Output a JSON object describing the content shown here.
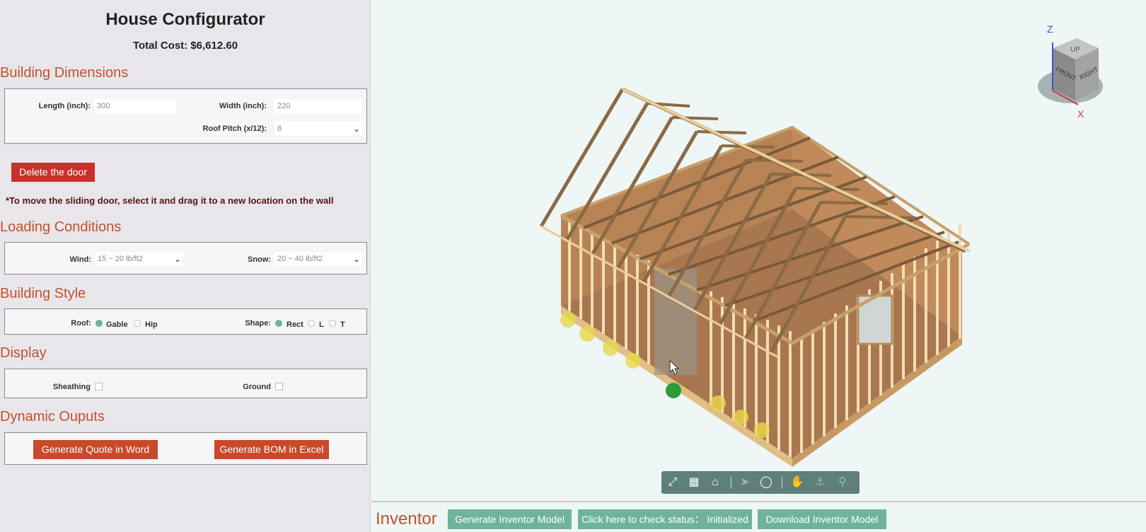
{
  "app": {
    "title": "House Configurator",
    "total_cost": "Total Cost: $6,612.60"
  },
  "sections": {
    "dimensions": "Building Dimensions",
    "loading": "Loading Conditions",
    "style": "Building Style",
    "display": "Display",
    "outputs": "Dynamic Ouputs"
  },
  "dimensions": {
    "length_label": "Length (inch):",
    "length_value": "300",
    "width_label": "Width (inch):",
    "width_value": "220",
    "pitch_label": "Roof Pitch (x/12):",
    "pitch_value": "8"
  },
  "door": {
    "delete_label": "Delete the door",
    "note": "*To move the sliding door, select it and drag it to a new location on the wall"
  },
  "loading": {
    "wind_label": "Wind:",
    "wind_value": "15 ~ 20 lb/ft2",
    "snow_label": "Snow:",
    "snow_value": "20 ~ 40 lb/ft2"
  },
  "style": {
    "roof_label": "Roof:",
    "roof_options": [
      "Gable",
      "Hip"
    ],
    "roof_selected": "Gable",
    "shape_label": "Shape:",
    "shape_options": [
      "Rect",
      "L",
      "T"
    ],
    "shape_selected": "Rect"
  },
  "display": {
    "sheathing_label": "Sheathing",
    "ground_label": "Ground"
  },
  "outputs": {
    "word_label": "Generate Quote in Word",
    "excel_label": "Generate BOM in Excel"
  },
  "viewcube": {
    "z": "Z",
    "x": "X",
    "up": "UP",
    "front": "FRONT",
    "right": "RIGHT"
  },
  "bottom": {
    "inventor_label": "Inventor",
    "generate_label": "Generate Inventor Model",
    "status_label": "Click here to check status： Initialized",
    "download_label": "Download Inventor Model"
  },
  "colors": {
    "accent": "#c0532b",
    "delete_button": "#c9312b",
    "teal": "#6fb39d",
    "wood": "#d9b27a",
    "floor": "#a8764f"
  }
}
